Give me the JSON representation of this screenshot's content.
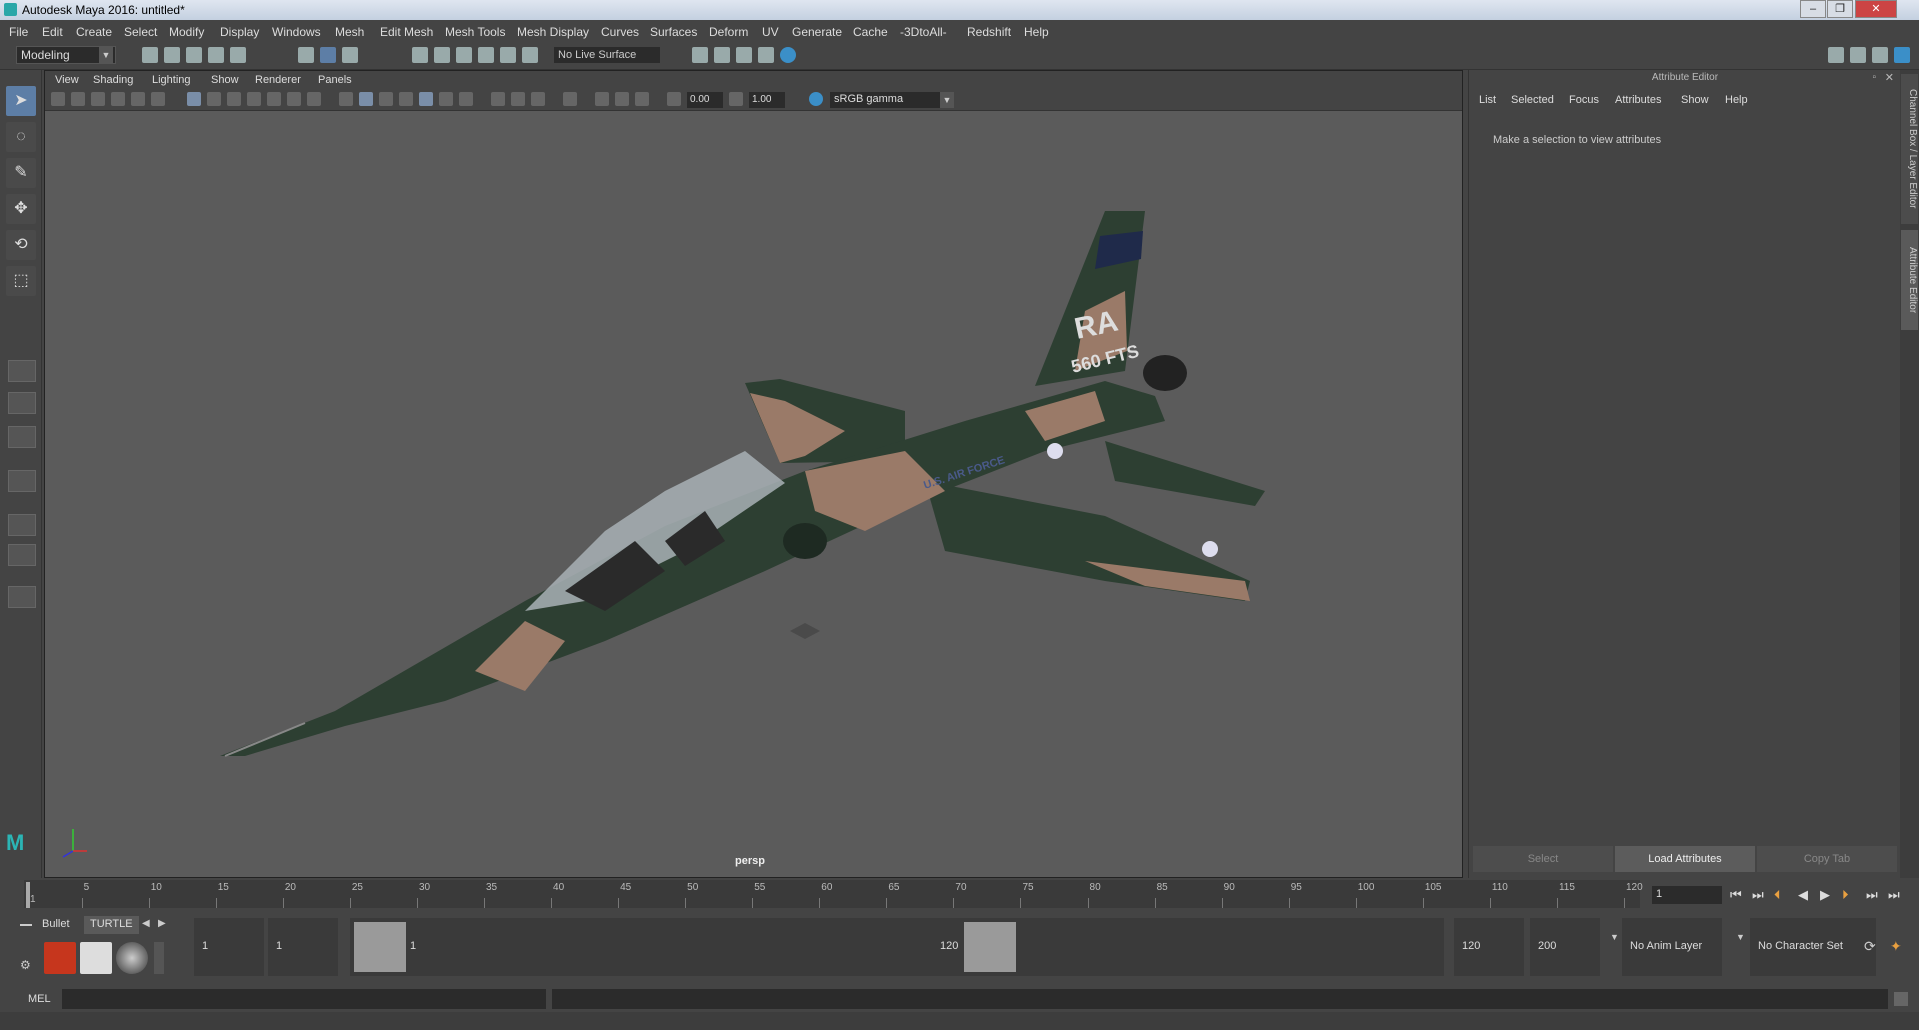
{
  "window": {
    "title": "Autodesk Maya 2016: untitled*"
  },
  "menu": [
    "File",
    "Edit",
    "Create",
    "Select",
    "Modify",
    "Display",
    "Windows",
    "Mesh",
    "Edit Mesh",
    "Mesh Tools",
    "Mesh Display",
    "Curves",
    "Surfaces",
    "Deform",
    "UV",
    "Generate",
    "Cache",
    "-3DtoAll-",
    "Redshift",
    "Help"
  ],
  "toolbar": {
    "mode": "Modeling",
    "live_surface": "No Live Surface"
  },
  "viewport": {
    "menu": [
      "View",
      "Shading",
      "Lighting",
      "Show",
      "Renderer",
      "Panels"
    ],
    "exposure": "0.00",
    "gamma_value": "1.00",
    "color_space": "sRGB gamma",
    "camera": "persp",
    "tail_code": "RA",
    "tail_unit": "560 FTS",
    "fuselage_text": "U.S. AIR FORCE"
  },
  "attribute_editor": {
    "header": "Attribute Editor",
    "menu": [
      "List",
      "Selected",
      "Focus",
      "Attributes",
      "Show",
      "Help"
    ],
    "message": "Make a selection to view attributes",
    "buttons": [
      "Select",
      "Load Attributes",
      "Copy Tab"
    ]
  },
  "side_tabs": [
    "Channel Box / Layer Editor",
    "Attribute Editor"
  ],
  "timeline": {
    "ticks": [
      "1",
      "5",
      "10",
      "15",
      "20",
      "25",
      "30",
      "35",
      "40",
      "45",
      "50",
      "55",
      "60",
      "65",
      "70",
      "75",
      "80",
      "85",
      "90",
      "95",
      "100",
      "105",
      "110",
      "115",
      "120"
    ],
    "current_frame": "1"
  },
  "range": {
    "shelf_tabs": [
      "Bullet",
      "TURTLE"
    ],
    "start": "1",
    "playback_start": "1",
    "slider_start": "1",
    "slider_end": "120",
    "playback_end": "120",
    "end": "200",
    "anim_layer": "No Anim Layer",
    "character_set": "No Character Set"
  },
  "command_line": {
    "label": "MEL"
  }
}
